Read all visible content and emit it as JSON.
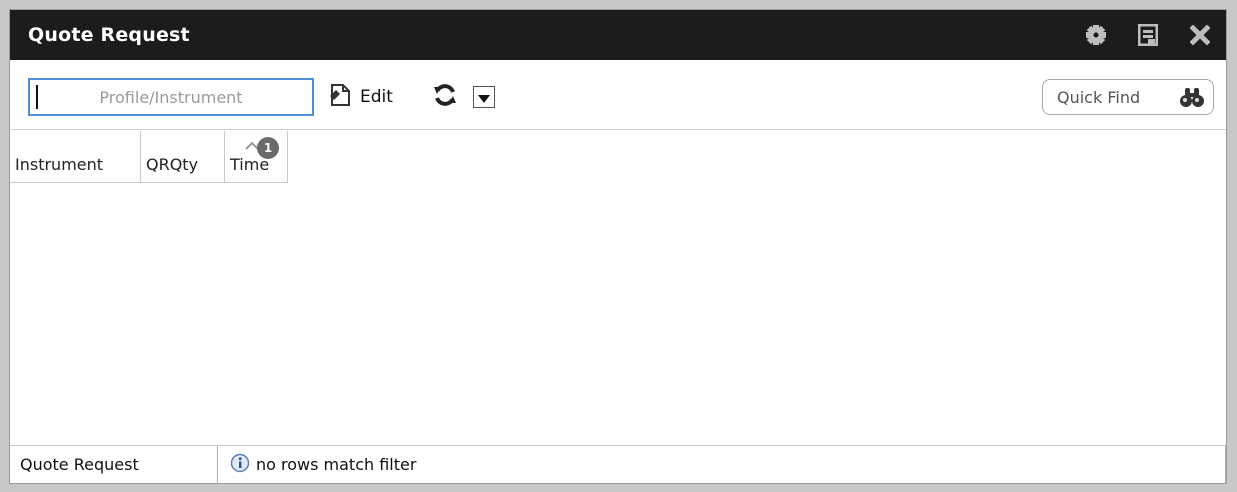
{
  "window": {
    "title": "Quote Request",
    "icons": [
      "gear-icon",
      "minimize-icon",
      "close-icon"
    ]
  },
  "toolbar": {
    "profile_placeholder": "Profile/Instrument",
    "edit_label": "Edit",
    "quickfind_placeholder": "Quick Find"
  },
  "grid": {
    "columns": [
      "Instrument",
      "QRQty",
      "Time"
    ],
    "sort_badge": "1",
    "rows": []
  },
  "status": {
    "panel_name": "Quote Request",
    "message": "no rows match filter"
  },
  "colors": {
    "titlebar": "#1c1c1c",
    "input_focus": "#4f8fd6",
    "status_divider": "#8fb3db"
  }
}
